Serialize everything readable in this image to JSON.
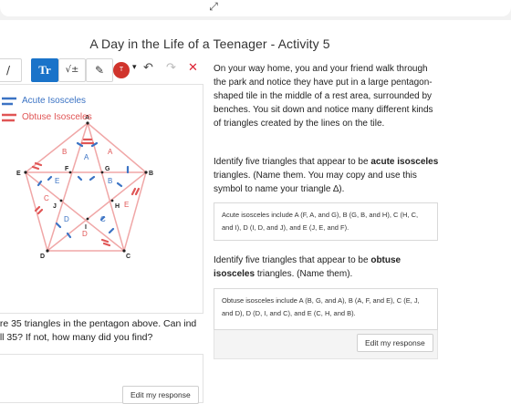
{
  "window": {
    "expand_glyph": "⤢"
  },
  "title": "A Day in the Life of a Teenager - Activity 5",
  "toolbar": {
    "items": [
      {
        "icon": "pen-icon",
        "glyph": "/"
      },
      {
        "icon": "text-tool-icon",
        "glyph": "Tr"
      },
      {
        "icon": "math-icon",
        "glyph": "√±"
      },
      {
        "icon": "eraser-icon",
        "glyph": "✎"
      }
    ],
    "color_initial": "T",
    "color_hex": "#d0342c",
    "caret": "▾",
    "undo": "↶",
    "redo": "↷",
    "close": "✕"
  },
  "legend": {
    "acute": "Acute Isosceles",
    "obtuse": "Obtuse Isosceles",
    "acute_color": "#3b73c4",
    "obtuse_color": "#e05555"
  },
  "diagram": {
    "vertices": [
      "A",
      "B",
      "C",
      "D",
      "E"
    ],
    "inner": [
      "F",
      "G",
      "H",
      "I",
      "J"
    ]
  },
  "left_question": "are 35 triangles in the pentagon above.  Can ind all 35?  If not, how many did you find?",
  "edit_label": "Edit my response",
  "intro": "On your way home, you and your friend walk through the park and notice they have put in a large pentagon-shaped tile in the middle of a rest area, surrounded by benches. You sit down and notice many different kinds of triangles created by the lines on the tile.",
  "q1": {
    "pre": "Identify five triangles that appear to be ",
    "bold": "acute isosceles",
    "post": " triangles. (Name them.  You may copy and use this symbol to name your triangle ∆)."
  },
  "a1": "Acute isosceles include A (F, A, and G), B (G, B, and H), C (H, C, and I), D (I, D, and J), and E (J, E, and F).",
  "q2": {
    "pre": "Identify five triangles that appear to be ",
    "bold": "obtuse isosceles",
    "post": " triangles. (Name them)."
  },
  "a2": "Obtuse isosceles include A (B, G, and A), B (A, F, and E), C (E, J, and D), D (D, I, and C), and E (C, H, and B)."
}
